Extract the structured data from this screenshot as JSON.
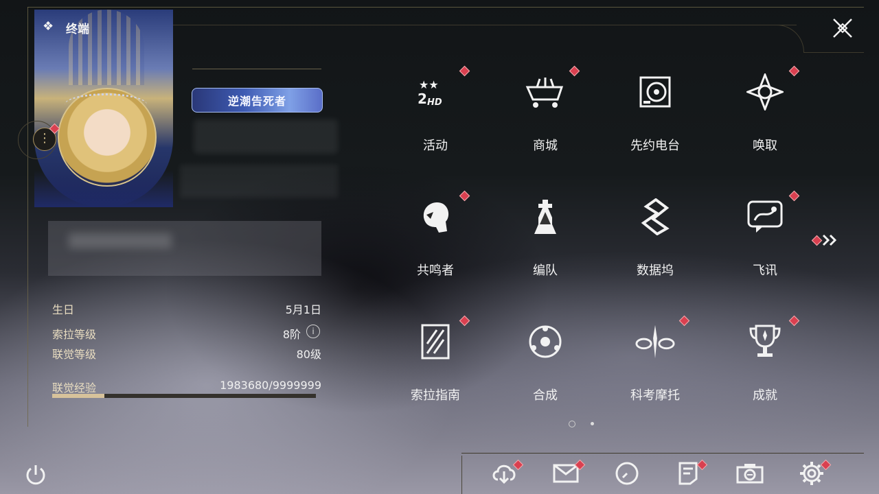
{
  "header": {
    "title": "终端"
  },
  "profile": {
    "title_badge": "逆潮告死者"
  },
  "stats": [
    {
      "label": "生日",
      "value": "5月1日"
    },
    {
      "label": "索拉等级",
      "value": "8阶"
    },
    {
      "label": "联觉等级",
      "value": "80级"
    }
  ],
  "experience": {
    "label": "联觉经验",
    "value": "1983680/9999999",
    "progress": 0.198
  },
  "grid": [
    {
      "label": "活动",
      "icon": "2hd-event-icon",
      "badge": true
    },
    {
      "label": "商城",
      "icon": "shop-cart-icon",
      "badge": true
    },
    {
      "label": "先约电台",
      "icon": "radio-icon",
      "badge": false
    },
    {
      "label": "唤取",
      "icon": "convene-icon",
      "badge": true
    },
    {
      "label": "共鸣者",
      "icon": "resonator-icon",
      "badge": true
    },
    {
      "label": "编队",
      "icon": "chess-team-icon",
      "badge": false
    },
    {
      "label": "数据坞",
      "icon": "data-bank-icon",
      "badge": false
    },
    {
      "label": "飞讯",
      "icon": "message-icon",
      "badge": true
    },
    {
      "label": "索拉指南",
      "icon": "guide-icon",
      "badge": true
    },
    {
      "label": "合成",
      "icon": "synthesis-icon",
      "badge": false
    },
    {
      "label": "科考摩托",
      "icon": "motorcycle-icon",
      "badge": true
    },
    {
      "label": "成就",
      "icon": "trophy-icon",
      "badge": true
    }
  ],
  "pagination": {
    "current": 1,
    "total": 2
  },
  "bottom_bar": [
    {
      "name": "download-icon",
      "badge": true
    },
    {
      "name": "mail-icon",
      "badge": true
    },
    {
      "name": "clock-icon",
      "badge": false
    },
    {
      "name": "notice-icon",
      "badge": true
    },
    {
      "name": "camera-icon",
      "badge": false
    },
    {
      "name": "settings-icon",
      "badge": true
    }
  ],
  "colors": {
    "accent_gold": "#d7c29b",
    "badge_red": "#d94050",
    "title_badge_blue": "#3e5bb3"
  }
}
